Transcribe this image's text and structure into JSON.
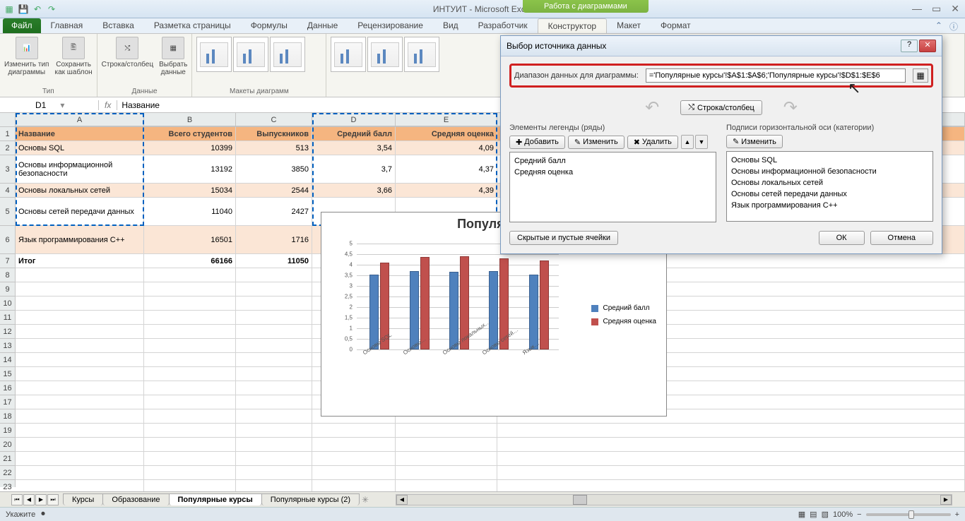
{
  "app": {
    "title": "ИНТУИТ - Microsoft Excel",
    "chart_tools_header": "Работа с диаграммами"
  },
  "ribbon": {
    "file": "Файл",
    "tabs": [
      "Главная",
      "Вставка",
      "Разметка страницы",
      "Формулы",
      "Данные",
      "Рецензирование",
      "Вид",
      "Разработчик",
      "Конструктор",
      "Макет",
      "Формат"
    ],
    "active_tab_index": 8,
    "groups": {
      "type": {
        "label": "Тип",
        "change_type": "Изменить тип\nдиаграммы",
        "save_template": "Сохранить\nкак шаблон"
      },
      "data": {
        "label": "Данные",
        "row_col": "Строка/столбец",
        "select_data": "Выбрать\nданные"
      },
      "layouts": {
        "label": "Макеты диаграмм"
      }
    }
  },
  "formula_bar": {
    "name_box": "D1",
    "formula": "Название"
  },
  "columns": [
    "A",
    "B",
    "C",
    "D",
    "E"
  ],
  "table": {
    "headers": [
      "Название",
      "Всего студентов",
      "Выпускников",
      "Средний балл",
      "Средняя оценка"
    ],
    "rows": [
      {
        "name": "Основы SQL",
        "students": 10399,
        "grads": 513,
        "avg_score": "3,54",
        "avg_grade": "4,09"
      },
      {
        "name": "Основы информационной безопасности",
        "students": 13192,
        "grads": 3850,
        "avg_score": "3,7",
        "avg_grade": "4,37"
      },
      {
        "name": "Основы локальных сетей",
        "students": 15034,
        "grads": 2544,
        "avg_score": "3,66",
        "avg_grade": "4,39"
      },
      {
        "name": "Основы сетей передачи данных",
        "students": 11040,
        "grads": 2427,
        "avg_score": "",
        "avg_grade": ""
      },
      {
        "name": "Язык программирования C++",
        "students": 16501,
        "grads": 1716,
        "avg_score": "",
        "avg_grade": ""
      }
    ],
    "total": {
      "name": "Итог",
      "students": 66166,
      "grads": 11050
    }
  },
  "chart_data": {
    "type": "bar",
    "title": "Популярны",
    "categories": [
      "Основы SQL",
      "Основы…",
      "Основы локальных…",
      "Основы сетей…",
      "Язык…"
    ],
    "series": [
      {
        "name": "Средний балл",
        "values": [
          3.54,
          3.7,
          3.66,
          3.7,
          3.55
        ],
        "color": "#4f81bd"
      },
      {
        "name": "Средняя оценка",
        "values": [
          4.09,
          4.37,
          4.39,
          4.3,
          4.2
        ],
        "color": "#c0504d"
      }
    ],
    "ylim": [
      0,
      5
    ],
    "ystep": 0.5,
    "ylabels": [
      "0",
      "0,5",
      "1",
      "1,5",
      "2",
      "2,5",
      "3",
      "3,5",
      "4",
      "4,5",
      "5"
    ]
  },
  "dialog": {
    "title": "Выбор источника данных",
    "range_label": "Диапазон данных для диаграммы:",
    "range_value": "='Популярные курсы'!$A$1:$A$6;'Популярные курсы'!$D$1:$E$6",
    "switch_button": "Строка/столбец",
    "legend_label": "Элементы легенды (ряды)",
    "axis_label": "Подписи горизонтальной оси (категории)",
    "add": "Добавить",
    "edit": "Изменить",
    "delete": "Удалить",
    "legend_items": [
      "Средний балл",
      "Средняя оценка"
    ],
    "axis_items": [
      "Основы SQL",
      "Основы информационной безопасности",
      "Основы локальных сетей",
      "Основы сетей передачи данных",
      "Язык программирования C++"
    ],
    "hidden_cells": "Скрытые и пустые ячейки",
    "ok": "ОК",
    "cancel": "Отмена"
  },
  "sheets": {
    "items": [
      "Курсы",
      "Образование",
      "Популярные курсы",
      "Популярные курсы (2)"
    ],
    "active_index": 2
  },
  "statusbar": {
    "mode": "Укажите",
    "zoom": "100%"
  }
}
